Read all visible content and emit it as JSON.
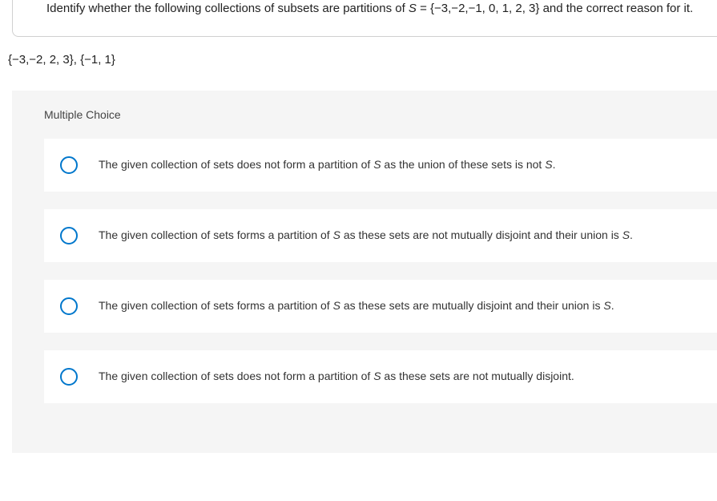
{
  "question": {
    "prompt_prefix": "Identify whether the following collections of subsets are partitions of ",
    "set_var": "S",
    "set_def": " = {−3,−2,−1, 0, 1, 2, 3} and the correct reason for it.",
    "subsets": "{−3,−2, 2, 3}, {−1, 1}"
  },
  "mc": {
    "header": "Multiple Choice",
    "options": [
      {
        "pre": "The given collection of sets does not form a partition of ",
        "var": "S",
        "mid": " as the union of these sets is not ",
        "var2": "S",
        "post": "."
      },
      {
        "pre": "The given collection of sets forms a partition of ",
        "var": "S",
        "mid": " as these sets are not mutually disjoint and their union is ",
        "var2": "S",
        "post": "."
      },
      {
        "pre": "The given collection of sets forms a partition of ",
        "var": "S",
        "mid": " as these sets are mutually disjoint and their union is ",
        "var2": "S",
        "post": "."
      },
      {
        "pre": "The given collection of sets does not form a partition of ",
        "var": "S",
        "mid": " as these sets are not mutually disjoint.",
        "var2": "",
        "post": ""
      }
    ]
  }
}
